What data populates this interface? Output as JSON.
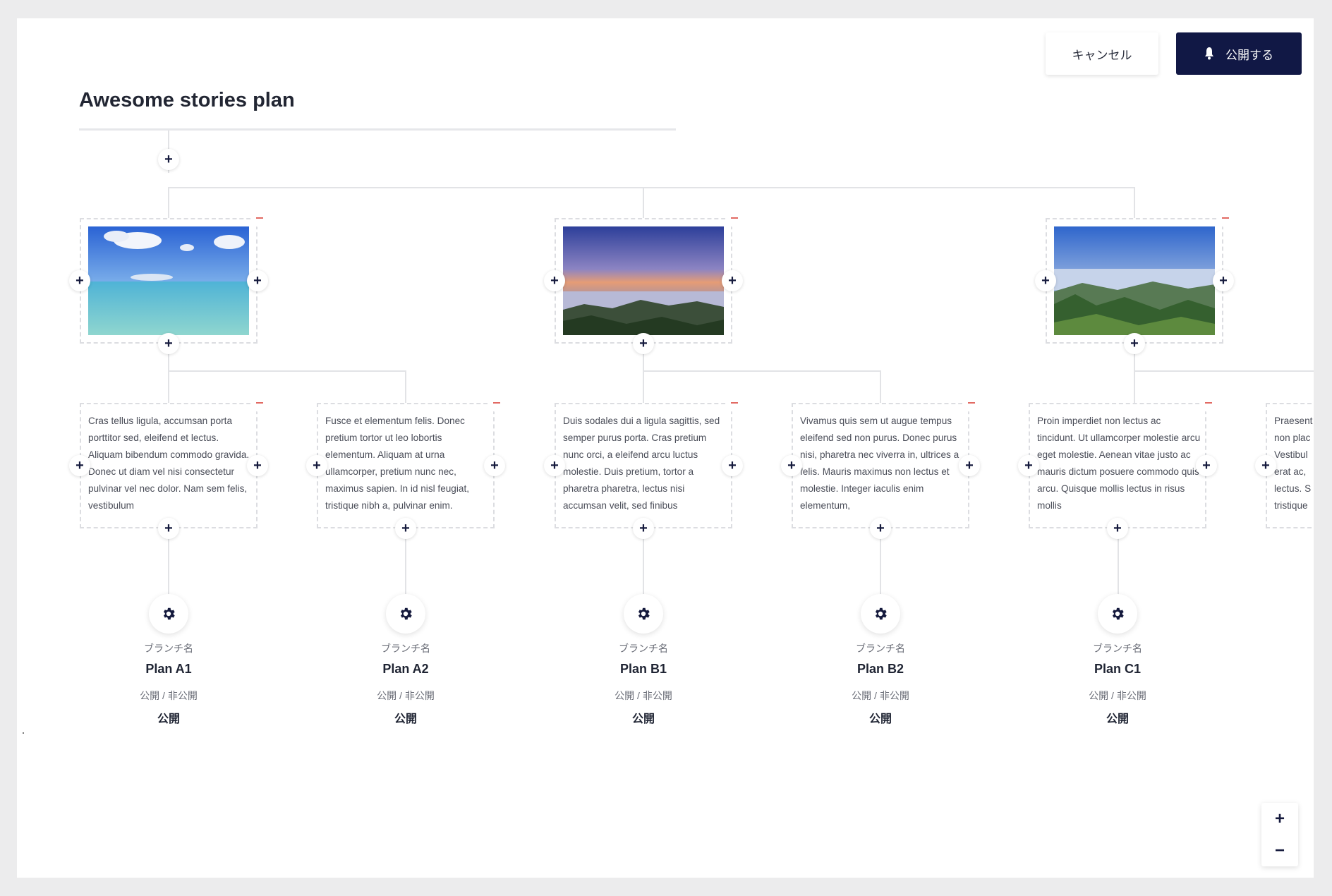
{
  "header": {
    "cancel_label": "キャンセル",
    "publish_label": "公開する",
    "title": "Awesome stories plan"
  },
  "photos": [
    {
      "name": "beach-photo",
      "colors": [
        "#2f6dd8",
        "#6ea6ec",
        "#4ec3cf",
        "#7fd2d0"
      ]
    },
    {
      "name": "sunset-mountain-photo",
      "colors": [
        "#2d3f9a",
        "#8a7fbf",
        "#e09a7a",
        "#2c4a2a"
      ]
    },
    {
      "name": "forest-valley-photo",
      "colors": [
        "#2f6bd0",
        "#9fb8e0",
        "#3e6a3a",
        "#27421f"
      ]
    }
  ],
  "texts": [
    "Cras tellus ligula, accumsan porta porttitor sed, eleifend et lectus. Aliquam bibendum commodo gravida. Donec ut diam vel nisi consectetur pulvinar vel nec dolor. Nam sem felis, vestibulum",
    "Fusce et elementum felis. Donec pretium tortor ut leo lobortis elementum. Aliquam at urna ullamcorper, pretium nunc nec, maximus sapien. In id nisl feugiat, tristique nibh a, pulvinar enim.",
    "Duis sodales dui a ligula sagittis, sed semper purus porta. Cras pretium nunc orci, a eleifend arcu luctus molestie. Duis pretium, tortor a pharetra pharetra, lectus nisi accumsan velit, sed finibus",
    "Vivamus quis sem ut augue tempus eleifend sed non purus. Donec purus nisi, pharetra nec viverra in, ultrices a felis. Mauris maximus non lectus et molestie. Integer iaculis enim elementum,",
    "Proin imperdiet non lectus ac tincidunt. Ut ullamcorper molestie arcu eget molestie. Aenean vitae justo ac mauris dictum posuere commodo quis arcu. Quisque mollis lectus in risus mollis",
    "Praesent non plac Vestibul erat ac, lectus. S tristique"
  ],
  "branches": [
    {
      "label": "ブランチ名",
      "name": "Plan A1",
      "visibility_label": "公開 / 非公開",
      "status": "公開"
    },
    {
      "label": "ブランチ名",
      "name": "Plan A2",
      "visibility_label": "公開 / 非公開",
      "status": "公開"
    },
    {
      "label": "ブランチ名",
      "name": "Plan B1",
      "visibility_label": "公開 / 非公開",
      "status": "公開"
    },
    {
      "label": "ブランチ名",
      "name": "Plan B2",
      "visibility_label": "公開 / 非公開",
      "status": "公開"
    },
    {
      "label": "ブランチ名",
      "name": "Plan C1",
      "visibility_label": "公開 / 非公開",
      "status": "公開"
    }
  ],
  "icons": {
    "add": "+",
    "zoom_in": "+",
    "zoom_out": "−"
  }
}
